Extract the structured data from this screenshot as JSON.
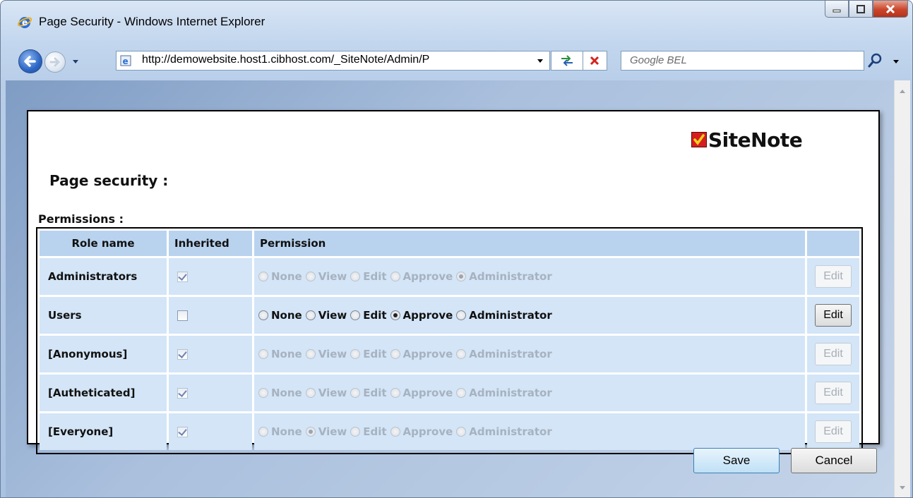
{
  "window": {
    "title": "Page Security - Windows Internet Explorer",
    "address": "http://demowebsite.host1.cibhost.com/_SiteNote/Admin/P",
    "search_placeholder": "Google BEL"
  },
  "page": {
    "logo_text": "SiteNote",
    "title": "Page security :",
    "permissions_label": "Permissions :"
  },
  "table": {
    "headers": [
      "Role name",
      "Inherited",
      "Permission",
      ""
    ],
    "options": [
      "None",
      "View",
      "Edit",
      "Approve",
      "Administrator"
    ],
    "edit_label": "Edit",
    "rows": [
      {
        "role": "Administrators",
        "inherited": true,
        "selected": "Administrator",
        "enabled": false
      },
      {
        "role": "Users",
        "inherited": false,
        "selected": "Approve",
        "enabled": true
      },
      {
        "role": "[Anonymous]",
        "inherited": true,
        "selected": "",
        "enabled": false
      },
      {
        "role": "[Autheticated]",
        "inherited": true,
        "selected": "",
        "enabled": false
      },
      {
        "role": "[Everyone]",
        "inherited": true,
        "selected": "View",
        "enabled": false
      }
    ]
  },
  "footer": {
    "save_label": "Save",
    "cancel_label": "Cancel"
  },
  "icons": {
    "browser_logo": "internet-explorer-icon",
    "back": "back-arrow-icon",
    "forward": "forward-arrow-icon",
    "refresh": "refresh-icon",
    "stop": "stop-icon",
    "search": "magnifier-icon"
  },
  "colors": {
    "header_cell": "#b9d3ef",
    "row_cell": "#d3e5f7",
    "logo_check": "#d61e1e"
  }
}
